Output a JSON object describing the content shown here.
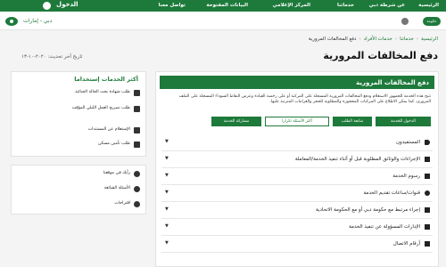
{
  "top_nav": {
    "items": [
      "الرئيسية",
      "عن شرطة دبي",
      "خدماتنا",
      "المركز الإعلامي",
      "البيانات المفتوحة",
      "تواصل معنا"
    ],
    "login": "الدخول"
  },
  "logo_bar": {
    "gov_logo_text": "حكومة",
    "uae_text": "دبي - إمارات"
  },
  "breadcrumb": [
    "الرئيسية",
    "خدماتنا",
    "خدمات الأفراد",
    "دفع المخالفات المرورية"
  ],
  "page_title": "دفع المخالفات المرورية",
  "updated": "تاريخ آخر تحديث: ٢٠٢٠-١٠-١٣",
  "main": {
    "section_title": "دفع المخالفات المرورية",
    "description": "تتيح هذه الخدمة للجمهور الاستعلام ودفع المخالفات المرورية المسجلة على المركبة أو على رخصة القيادة وعرض النقاط السوداء المسجلة على الملف المروري، كما يمكن الاطلاع على المركبات المحجوزة والمطلوبة للحجز والغرامات المترتبة عليها.",
    "buttons": {
      "start": "الدخول للخدمة",
      "follow": "متابعة الطلب",
      "more": "أكثر الأسئلة تكرارا",
      "share": "مشاركة الخدمة"
    },
    "accordion": [
      "المستفيدون",
      "الإجراءات والوثائق المطلوبة قبل أو أثناء تنفيذ الخدمة/المعاملة",
      "رسوم الخدمة",
      "قنوات/ساعات تقديم الخدمة",
      "إجراء مرتبط مع حكومة دبي أو مع الحكومة الاتحادية",
      "الإدارات المسؤولة عن تنفيذ الخدمة",
      "أرقام الاتصال"
    ]
  },
  "sidebar": {
    "title": "أكثر الخدمات إستخداما",
    "items": [
      "طلب شهادة بحث الحالة الجنائية",
      "طلب تصريح العمل الليلي المؤقت",
      "الإستعلام عن المستندات",
      "طلب تأمين مسكن"
    ],
    "help": [
      "رأيك في موقعنا",
      "الأسئلة الشائعة",
      "اقتراحات"
    ]
  }
}
